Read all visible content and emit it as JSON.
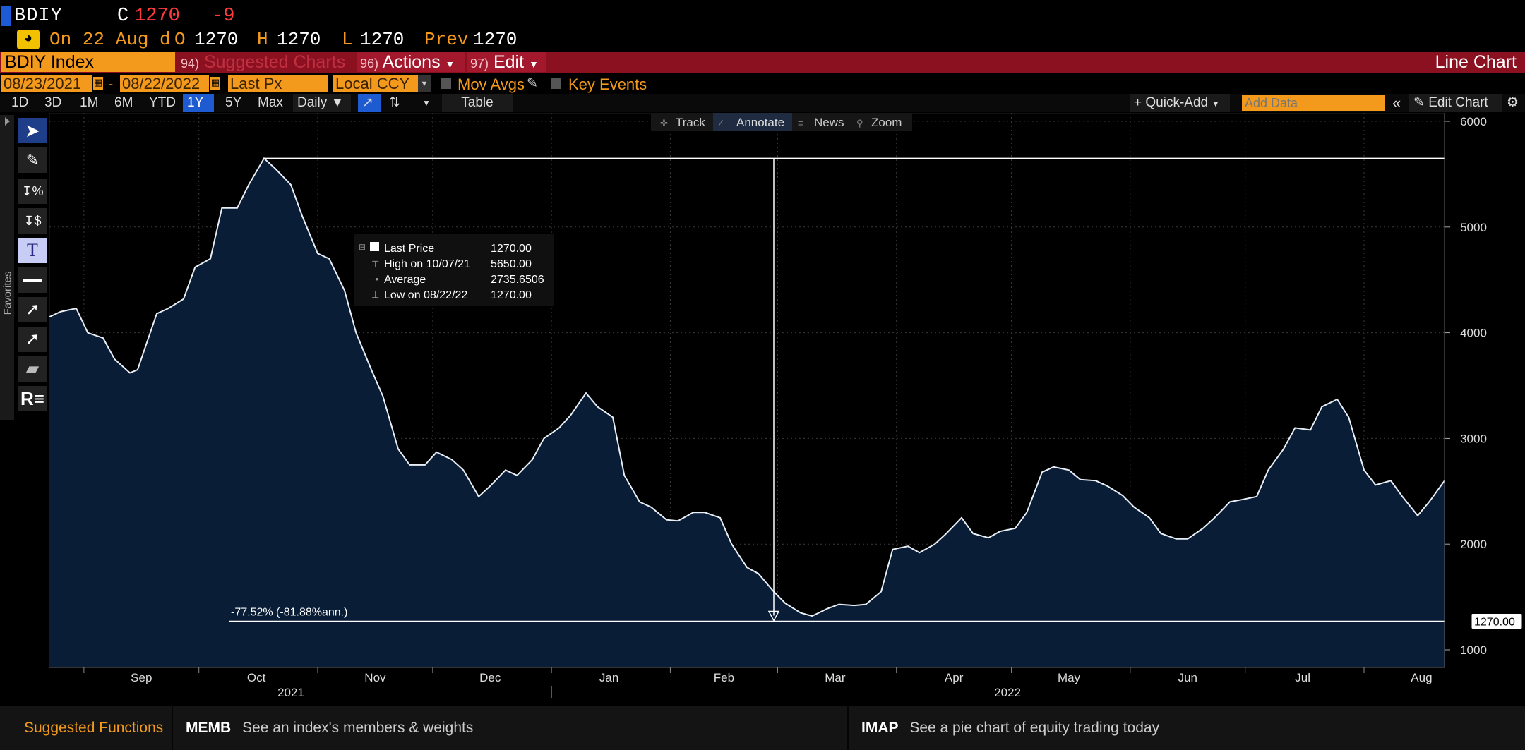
{
  "header": {
    "ticker": "BDIY",
    "close_label": "C",
    "close_value": "1270",
    "change": "-9",
    "date_line": "On 22 Aug d",
    "open_label": "O",
    "open_value": "1270",
    "high_label": "H",
    "high_value": "1270",
    "low_label": "L",
    "low_value": "1270",
    "prev_label": "Prev",
    "prev_value": "1270"
  },
  "toolbar": {
    "security": "BDIY Index",
    "suggested_num": "94)",
    "suggested_label": "Suggested Charts",
    "actions_num": "96)",
    "actions_label": "Actions",
    "edit_num": "97)",
    "edit_label": "Edit",
    "chart_type_title": "Line Chart"
  },
  "inputs": {
    "start_date": "08/23/2021",
    "end_date": "08/22/2022",
    "field": "Last Px",
    "currency": "Local CCY",
    "mov_avgs": "Mov Avgs",
    "key_events": "Key Events"
  },
  "timeframes": [
    "1D",
    "3D",
    "1M",
    "6M",
    "YTD",
    "1Y",
    "5Y",
    "Max"
  ],
  "selected_timeframe": "1Y",
  "period": "Daily",
  "table_button": "Table",
  "quick_add": "+ Quick-Add",
  "add_data_placeholder": "Add Data",
  "edit_chart": "Edit Chart",
  "chart_tools": {
    "track": "Track",
    "annotate": "Annotate",
    "news": "News",
    "zoom": "Zoom"
  },
  "favorites_label": "Favorites",
  "legend": {
    "last_price_label": "Last Price",
    "last_price_value": "1270.00",
    "high_label": "High on 10/07/21",
    "high_value": "5650.00",
    "average_label": "Average",
    "average_value": "2735.6506",
    "low_label": "Low on 08/22/22",
    "low_value": "1270.00"
  },
  "annotation_text": "-77.52% (-81.88%ann.)",
  "last_value_tag": "1270.00",
  "chart_data": {
    "type": "area",
    "title": "",
    "xlabel": "",
    "ylabel": "",
    "x_tick_labels": [
      "Sep",
      "Oct",
      "Nov",
      "Dec",
      "Jan",
      "Feb",
      "Mar",
      "Apr",
      "May",
      "Jun",
      "Jul",
      "Aug"
    ],
    "year_labels": [
      "2021",
      "2022"
    ],
    "y_tick_labels": [
      "1000",
      "2000",
      "3000",
      "4000",
      "5000",
      "6000"
    ],
    "ylim": [
      1000,
      6000
    ],
    "xlim": [
      "2021-08-23",
      "2022-08-22"
    ],
    "grid": true,
    "series": [
      {
        "name": "Last Price",
        "color": "#ffffff",
        "fill": "#0a1d36",
        "points": [
          [
            "2021-08-23",
            4150
          ],
          [
            "2021-08-26",
            4200
          ],
          [
            "2021-08-30",
            4230
          ],
          [
            "2021-09-02",
            4000
          ],
          [
            "2021-09-06",
            3950
          ],
          [
            "2021-09-09",
            3750
          ],
          [
            "2021-09-13",
            3620
          ],
          [
            "2021-09-15",
            3650
          ],
          [
            "2021-09-20",
            4180
          ],
          [
            "2021-09-23",
            4230
          ],
          [
            "2021-09-27",
            4320
          ],
          [
            "2021-09-30",
            4620
          ],
          [
            "2021-10-04",
            4700
          ],
          [
            "2021-10-07",
            5180
          ],
          [
            "2021-10-11",
            5180
          ],
          [
            "2021-10-14",
            5400
          ],
          [
            "2021-10-18",
            5650
          ],
          [
            "2021-10-21",
            5550
          ],
          [
            "2021-10-25",
            5400
          ],
          [
            "2021-10-28",
            5100
          ],
          [
            "2021-11-01",
            4750
          ],
          [
            "2021-11-04",
            4700
          ],
          [
            "2021-11-08",
            4400
          ],
          [
            "2021-11-11",
            4000
          ],
          [
            "2021-11-15",
            3650
          ],
          [
            "2021-11-18",
            3400
          ],
          [
            "2021-11-22",
            2900
          ],
          [
            "2021-11-25",
            2750
          ],
          [
            "2021-11-29",
            2750
          ],
          [
            "2021-12-02",
            2870
          ],
          [
            "2021-12-06",
            2800
          ],
          [
            "2021-12-09",
            2700
          ],
          [
            "2021-12-13",
            2450
          ],
          [
            "2021-12-16",
            2550
          ],
          [
            "2021-12-20",
            2700
          ],
          [
            "2021-12-23",
            2650
          ],
          [
            "2021-12-27",
            2800
          ],
          [
            "2021-12-30",
            3000
          ],
          [
            "2022-01-03",
            3100
          ],
          [
            "2022-01-06",
            3220
          ],
          [
            "2022-01-10",
            3430
          ],
          [
            "2022-01-13",
            3300
          ],
          [
            "2022-01-17",
            3200
          ],
          [
            "2022-01-20",
            2650
          ],
          [
            "2022-01-24",
            2400
          ],
          [
            "2022-01-27",
            2350
          ],
          [
            "2022-01-31",
            2230
          ],
          [
            "2022-02-03",
            2220
          ],
          [
            "2022-02-07",
            2300
          ],
          [
            "2022-02-10",
            2300
          ],
          [
            "2022-02-14",
            2250
          ],
          [
            "2022-02-17",
            2000
          ],
          [
            "2022-02-21",
            1780
          ],
          [
            "2022-02-24",
            1720
          ],
          [
            "2022-02-28",
            1550
          ],
          [
            "2022-03-03",
            1440
          ],
          [
            "2022-03-07",
            1350
          ],
          [
            "2022-03-10",
            1320
          ],
          [
            "2022-03-14",
            1390
          ],
          [
            "2022-03-17",
            1430
          ],
          [
            "2022-03-21",
            1420
          ],
          [
            "2022-03-24",
            1430
          ],
          [
            "2022-03-28",
            1550
          ],
          [
            "2022-03-31",
            1950
          ],
          [
            "2022-04-04",
            1980
          ],
          [
            "2022-04-07",
            1920
          ],
          [
            "2022-04-11",
            2000
          ],
          [
            "2022-04-14",
            2100
          ],
          [
            "2022-04-18",
            2250
          ],
          [
            "2022-04-21",
            2100
          ],
          [
            "2022-04-25",
            2060
          ],
          [
            "2022-04-28",
            2120
          ],
          [
            "2022-05-02",
            2150
          ],
          [
            "2022-05-05",
            2300
          ],
          [
            "2022-05-09",
            2680
          ],
          [
            "2022-05-12",
            2730
          ],
          [
            "2022-05-16",
            2700
          ],
          [
            "2022-05-19",
            2610
          ],
          [
            "2022-05-23",
            2600
          ],
          [
            "2022-05-26",
            2550
          ],
          [
            "2022-05-30",
            2460
          ],
          [
            "2022-06-02",
            2350
          ],
          [
            "2022-06-06",
            2250
          ],
          [
            "2022-06-09",
            2100
          ],
          [
            "2022-06-13",
            2050
          ],
          [
            "2022-06-16",
            2050
          ],
          [
            "2022-06-20",
            2150
          ],
          [
            "2022-06-23",
            2250
          ],
          [
            "2022-06-27",
            2400
          ],
          [
            "2022-06-30",
            2420
          ],
          [
            "2022-07-04",
            2450
          ],
          [
            "2022-07-07",
            2700
          ],
          [
            "2022-07-11",
            2900
          ],
          [
            "2022-07-14",
            3100
          ],
          [
            "2022-07-18",
            3080
          ],
          [
            "2022-07-21",
            3300
          ],
          [
            "2022-07-25",
            3370
          ],
          [
            "2022-07-28",
            3200
          ],
          [
            "2022-08-01",
            2700
          ],
          [
            "2022-08-04",
            2560
          ],
          [
            "2022-08-08",
            2600
          ],
          [
            "2022-08-11",
            2450
          ],
          [
            "2022-08-15",
            2270
          ],
          [
            "2022-08-18",
            2400
          ],
          [
            "2022-08-22",
            2600
          ]
        ]
      }
    ],
    "high_line_value": 5650,
    "low_line_value": 1270
  },
  "footer": {
    "title": "Suggested Functions",
    "fn1_code": "MEMB",
    "fn1_desc": "See an index's members & weights",
    "fn2_code": "IMAP",
    "fn2_desc": "See a pie chart of equity trading today"
  }
}
